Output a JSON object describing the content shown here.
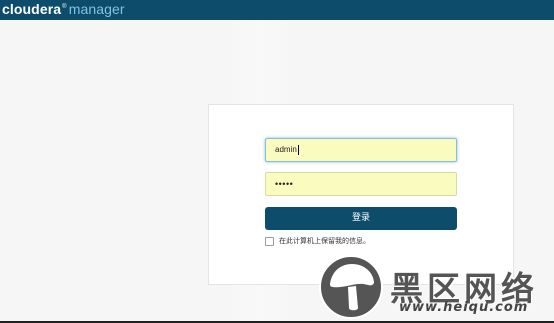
{
  "header": {
    "brand": "cloudera",
    "brand_mark": "®",
    "product": "manager"
  },
  "login": {
    "username_value": "admin",
    "password_mask": "•••••",
    "submit_label": "登录",
    "remember_label": "在此计算机上保留我的信息。",
    "remember_checked": false
  },
  "watermark": {
    "icon": "mushroom-logo-icon",
    "title": "黑区网络",
    "url": "www.heiqu.com"
  },
  "colors": {
    "topbar": "#0e4c6b",
    "brand_accent": "#7fc3e6",
    "field_bg": "#fafcbf",
    "button_bg": "#0e4c6b"
  }
}
